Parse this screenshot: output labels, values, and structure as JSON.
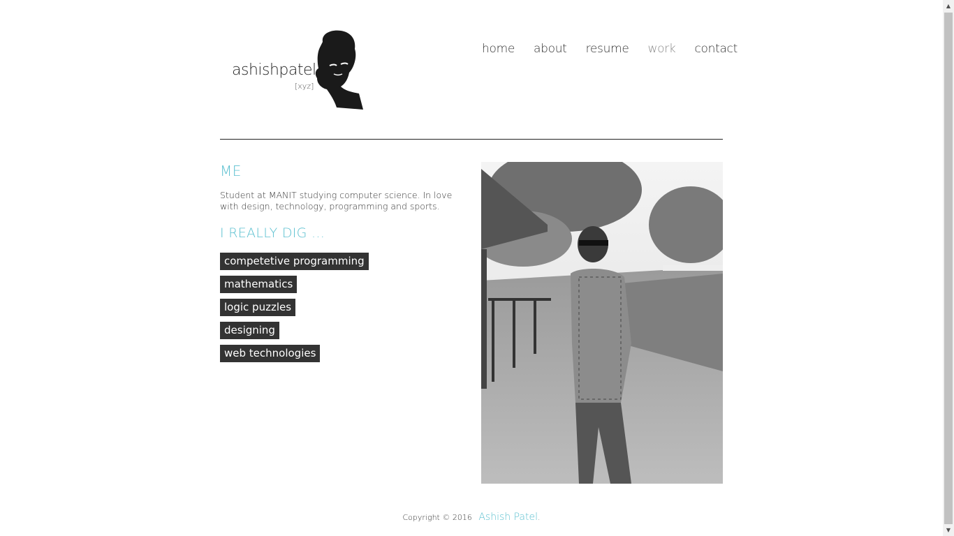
{
  "header": {
    "logo_name": "ashishpatel",
    "logo_tag": "[xyz]"
  },
  "nav": {
    "items": [
      {
        "label": "home"
      },
      {
        "label": "about"
      },
      {
        "label": "resume"
      },
      {
        "label": "work"
      },
      {
        "label": "contact"
      }
    ]
  },
  "main": {
    "me_heading": "ME",
    "bio": "Student at MANIT studying computer science. In love with design, technology, programming and sports.",
    "dig_heading": "I REALLY DIG ...",
    "tags": [
      {
        "label": "competetive programming"
      },
      {
        "label": "mathematics"
      },
      {
        "label": "logic puzzles"
      },
      {
        "label": "designing"
      },
      {
        "label": "web technologies"
      }
    ]
  },
  "footer": {
    "copyright": "Copyright © 2016",
    "author": "Ashish Patel",
    "period": "."
  },
  "colors": {
    "accent": "#5bc0d0",
    "tag_bg": "#333333",
    "rule": "#222222"
  }
}
